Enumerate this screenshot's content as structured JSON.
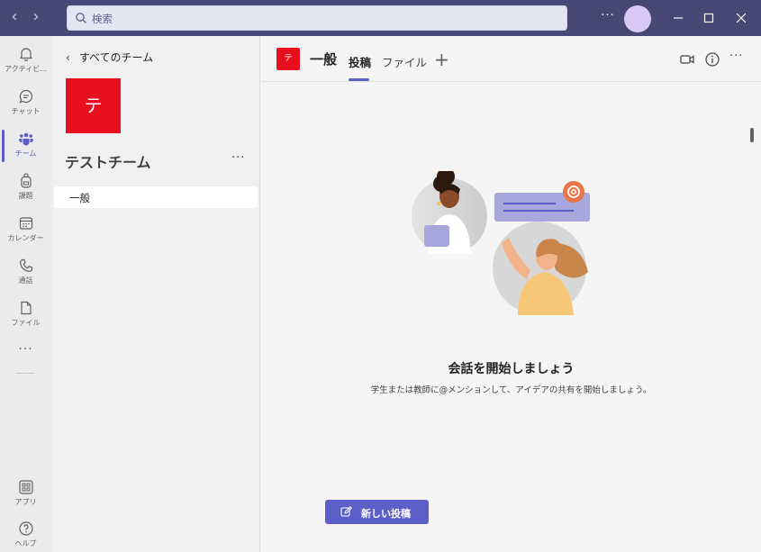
{
  "titlebar": {
    "back_icon": "chevron-left-icon",
    "forward_icon": "chevron-right-icon",
    "search_placeholder": "検索",
    "more_label": "···",
    "colors": {
      "bar": "#464775",
      "avatar": "#d8c9f4"
    }
  },
  "rail": {
    "items": [
      {
        "label": "アクティビ...",
        "icon": "bell-icon"
      },
      {
        "label": "チャット",
        "icon": "chat-icon"
      },
      {
        "label": "チーム",
        "icon": "teams-icon",
        "active": true
      },
      {
        "label": "課題",
        "icon": "backpack-icon"
      },
      {
        "label": "カレンダー",
        "icon": "calendar-icon"
      },
      {
        "label": "通話",
        "icon": "phone-icon"
      },
      {
        "label": "ファイル",
        "icon": "file-icon"
      }
    ],
    "more_label": "···",
    "bottom": [
      {
        "label": "アプリ",
        "icon": "apps-icon"
      },
      {
        "label": "ヘルプ",
        "icon": "help-icon"
      }
    ]
  },
  "team_pane": {
    "back_label": "すべてのチーム",
    "tile_letter": "テ",
    "team_name": "テストチーム",
    "more_label": "···",
    "channels": [
      {
        "label": "一般",
        "selected": true
      }
    ]
  },
  "channel_header": {
    "tile_letter": "テ",
    "title": "一般",
    "tabs": [
      {
        "label": "投稿",
        "active": true
      },
      {
        "label": "ファイル",
        "active": false
      }
    ],
    "add_tab_label": "+",
    "more_label": "···",
    "accent": "#5b5fc7",
    "team_color": "#e8101e"
  },
  "empty_state": {
    "title": "会話を開始しましょう",
    "subtitle": "学生または教師に@メンションして、アイデアの共有を開始しましょう。"
  },
  "compose": {
    "new_post_label": "新しい投稿"
  }
}
